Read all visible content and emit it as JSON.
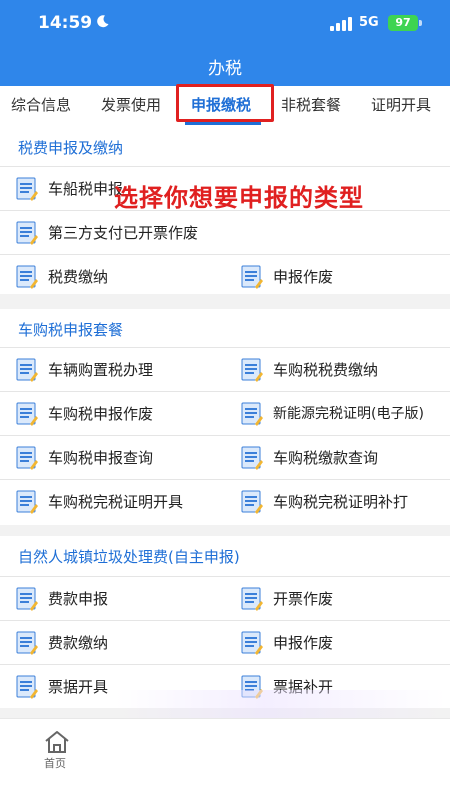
{
  "status_bar": {
    "time": "14:59",
    "network": "5G",
    "battery": "97"
  },
  "header": {
    "title": "办税"
  },
  "tabs": [
    {
      "label": "综合信息",
      "active": false
    },
    {
      "label": "发票使用",
      "active": false
    },
    {
      "label": "申报缴税",
      "active": true
    },
    {
      "label": "非税套餐",
      "active": false
    },
    {
      "label": "证明开具",
      "active": false
    }
  ],
  "overlay_caption": "选择你想要申报的类型",
  "sections": [
    {
      "title": "税费申报及缴纳",
      "items": [
        "车船税申报",
        "第三方支付已开票作废",
        "税费缴纳",
        "申报作废"
      ]
    },
    {
      "title": "车购税申报套餐",
      "items": [
        "车辆购置税办理",
        "车购税税费缴纳",
        "车购税申报作废",
        "新能源完税证明(电子版)",
        "车购税申报查询",
        "车购税缴款查询",
        "车购税完税证明开具",
        "车购税完税证明补打"
      ]
    },
    {
      "title": "自然人城镇垃圾处理费(自主申报)",
      "items": [
        "费款申报",
        "开票作废",
        "费款缴纳",
        "申报作废",
        "票据开具",
        "票据补开"
      ]
    }
  ],
  "bottom_nav": {
    "home_label": "首页"
  },
  "colors": {
    "brand_blue": "#2f86ea",
    "accent_blue": "#1f6fd6",
    "highlight_red": "#e02020"
  },
  "icons": {
    "item_icon": "document-icon",
    "home_icon": "home-icon"
  }
}
